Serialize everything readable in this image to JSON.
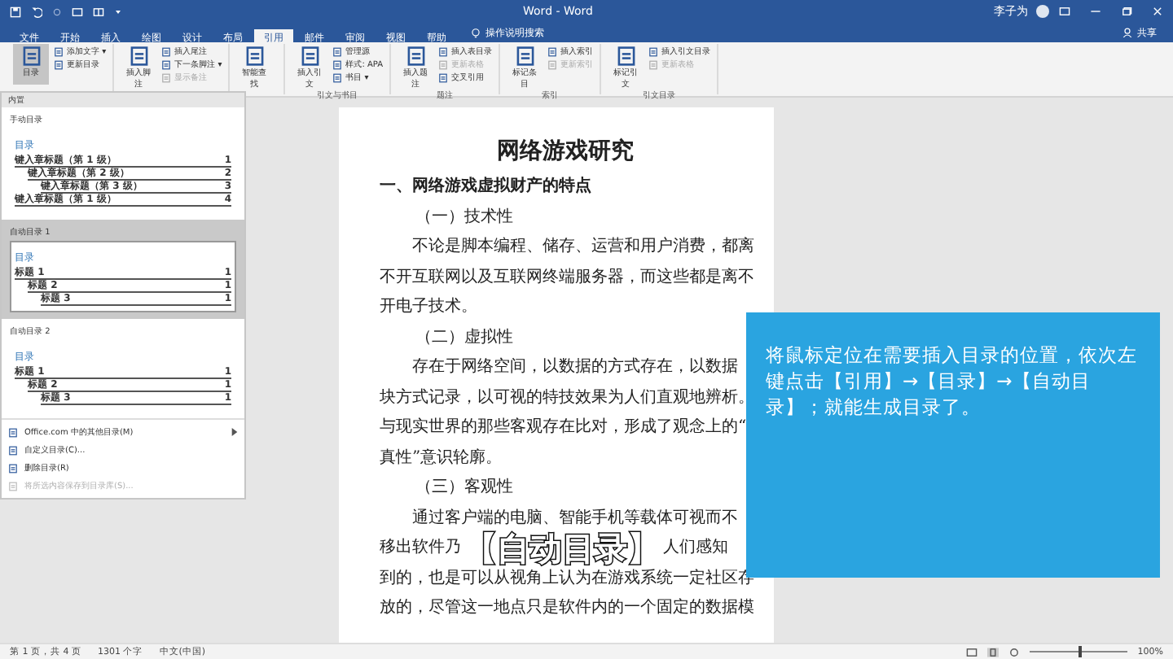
{
  "window": {
    "title": "Word - Word",
    "user": "李子为",
    "share": "共享"
  },
  "tabs": [
    {
      "label": "文件",
      "selected": false
    },
    {
      "label": "开始",
      "selected": false
    },
    {
      "label": "插入",
      "selected": false
    },
    {
      "label": "绘图",
      "selected": false
    },
    {
      "label": "设计",
      "selected": false
    },
    {
      "label": "布局",
      "selected": false
    },
    {
      "label": "引用",
      "selected": true
    },
    {
      "label": "邮件",
      "selected": false
    },
    {
      "label": "审阅",
      "selected": false
    },
    {
      "label": "视图",
      "selected": false
    },
    {
      "label": "帮助",
      "selected": false
    }
  ],
  "tell_me": "操作说明搜索",
  "ribbon": {
    "groups": [
      {
        "buttons": [
          {
            "kind": "large",
            "label": "目录",
            "pressed": true
          },
          {
            "kind": "small",
            "label": "添加文字 ▾",
            "disabled": false
          },
          {
            "kind": "small",
            "label": "更新目录",
            "disabled": false
          }
        ]
      },
      {
        "buttons": [
          {
            "kind": "large",
            "label": "插入脚注",
            "pressed": false
          },
          {
            "kind": "small",
            "label": "插入尾注",
            "disabled": false
          },
          {
            "kind": "small",
            "label": "下一条脚注 ▾",
            "disabled": false
          },
          {
            "kind": "small",
            "label": "显示备注",
            "disabled": true
          }
        ]
      },
      {
        "buttons": [
          {
            "kind": "large",
            "label": "智能查找",
            "pressed": false
          }
        ]
      },
      {
        "label": "引文与书目",
        "buttons": [
          {
            "kind": "large",
            "label": "插入引文",
            "pressed": false
          },
          {
            "kind": "small",
            "label": "管理源",
            "disabled": false
          },
          {
            "kind": "small",
            "label": "样式: APA",
            "disabled": false
          },
          {
            "kind": "small",
            "label": "书目 ▾",
            "disabled": false
          }
        ]
      },
      {
        "label": "题注",
        "buttons": [
          {
            "kind": "large",
            "label": "插入题注",
            "pressed": false
          },
          {
            "kind": "small",
            "label": "插入表目录",
            "disabled": false
          },
          {
            "kind": "small",
            "label": "更新表格",
            "disabled": true
          },
          {
            "kind": "small",
            "label": "交叉引用",
            "disabled": false
          }
        ]
      },
      {
        "label": "索引",
        "buttons": [
          {
            "kind": "large",
            "label": "标记条目",
            "pressed": false
          },
          {
            "kind": "small",
            "label": "插入索引",
            "disabled": false
          },
          {
            "kind": "small",
            "label": "更新索引",
            "disabled": true
          }
        ]
      },
      {
        "label": "引文目录",
        "buttons": [
          {
            "kind": "large",
            "label": "标记引文",
            "pressed": false
          },
          {
            "kind": "small",
            "label": "插入引文目录",
            "disabled": false
          },
          {
            "kind": "small",
            "label": "更新表格",
            "disabled": true
          }
        ]
      }
    ]
  },
  "toc_menu": {
    "header": "内置",
    "styles": [
      {
        "name": "手动目录",
        "selected": false,
        "heading": "目录",
        "entries": [
          {
            "text": "键入章标题（第 1 级）",
            "page": "1",
            "children": [
              {
                "text": "键入章标题（第 2 级）",
                "page": "2",
                "children": [
                  {
                    "text": "键入章标题（第 3 级）",
                    "page": "3"
                  }
                ]
              }
            ]
          },
          {
            "text": "键入章标题（第 1 级）",
            "page": "4"
          }
        ]
      },
      {
        "name": "自动目录 1",
        "selected": true,
        "heading": "目录",
        "entries": [
          {
            "text": "标题 1",
            "page": "1",
            "children": [
              {
                "text": "标题 2",
                "page": "1",
                "children": [
                  {
                    "text": "标题 3",
                    "page": "1"
                  }
                ]
              }
            ]
          }
        ]
      },
      {
        "name": "自动目录 2",
        "selected": false,
        "heading": "目录",
        "entries": [
          {
            "text": "标题 1",
            "page": "1",
            "children": [
              {
                "text": "标题 2",
                "page": "1",
                "children": [
                  {
                    "text": "标题 3",
                    "page": "1"
                  }
                ]
              }
            ]
          }
        ]
      }
    ],
    "commands": [
      {
        "label": "Office.com 中的其他目录(M)",
        "disabled": false,
        "submenu": true
      },
      {
        "label": "自定义目录(C)...",
        "disabled": false,
        "submenu": false
      },
      {
        "label": "删除目录(R)",
        "disabled": false,
        "submenu": false
      },
      {
        "label": "将所选内容保存到目录库(S)...",
        "disabled": true,
        "submenu": false
      }
    ]
  },
  "document": {
    "lines": [
      {
        "kind": "title",
        "text": "网络游戏研究"
      },
      {
        "kind": "heading",
        "text": "一、网络游戏虚拟财产的特点"
      },
      {
        "kind": "subheading",
        "text": "（一）技术性"
      },
      {
        "kind": "first",
        "text": "不论是脚本编程、储存、运营和用户消费，都离"
      },
      {
        "kind": "body",
        "text": "不开互联网以及互联网终端服务器，而这些都是离不"
      },
      {
        "kind": "body",
        "text": "开电子技术。"
      },
      {
        "kind": "subheading",
        "text": "（二）虚拟性"
      },
      {
        "kind": "first",
        "text": "存在于网络空间，以数据的方式存在，以数据"
      },
      {
        "kind": "body",
        "text": "块方式记录，以可视的特技效果为人们直观地辨析。"
      },
      {
        "kind": "body",
        "text": "与现实世界的那些客观存在比对，形成了观念上的“"
      },
      {
        "kind": "body",
        "text": "真性”意识轮廓。"
      },
      {
        "kind": "subheading",
        "text": "（三）客观性"
      },
      {
        "kind": "first",
        "text": "通过客户端的电脑、智能手机等载体可视而不"
      },
      {
        "kind": "captioned",
        "text": "移出软件乃",
        "after": "人们感知",
        "caption": "【自动目录】"
      },
      {
        "kind": "body",
        "text": "到的，也是可以从视角上认为在游戏系统一定社区存"
      },
      {
        "kind": "body",
        "text": "放的，尽管这一地点只是软件内的一个固定的数据模"
      }
    ]
  },
  "callout": "将鼠标定位在需要插入目录的位置，依次左键点击【引用】→【目录】→【自动目录】；就能生成目录了。",
  "status_bar": {
    "page": "第 1 页，共 4 页",
    "words": "1301 个字",
    "language": "中文(中国)",
    "zoom": "100%",
    "zoom_slider": {
      "level": 0.5
    }
  }
}
